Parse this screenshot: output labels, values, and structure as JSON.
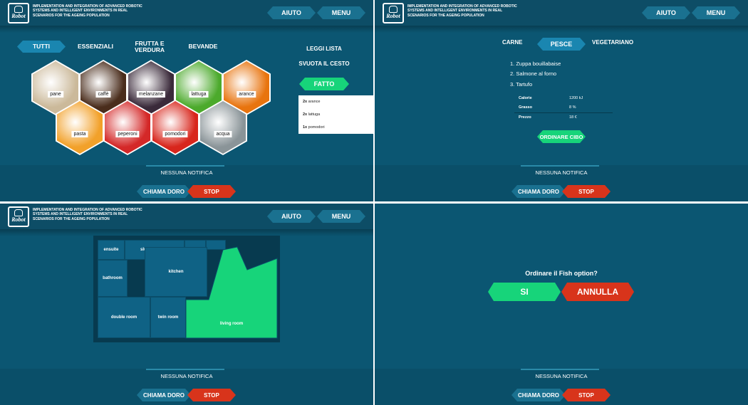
{
  "header": {
    "logo_text": "Robot",
    "project_text": "IMPLEMENTATION AND INTEGRATION OF ADVANCED ROBOTIC SYSTEMS AND INTELLIGENT ENVIRONMENTS IN REAL SCENARIOS FOR THE AGEING POPULATION",
    "aiuto": "AIUTO",
    "menu": "MENU"
  },
  "footer": {
    "notifica": "NESSUNA NOTIFICA",
    "chiama": "CHIAMA DORO",
    "stop": "STOP"
  },
  "shopping": {
    "tabs": [
      "TUTTI",
      "ESSENZIALI",
      "FRUTTA E VERDURA",
      "BEVANDE"
    ],
    "active_tab": "TUTTI",
    "items": [
      {
        "label": "pane",
        "color": "#cbb99a"
      },
      {
        "label": "caffè",
        "color": "#4a2d1c"
      },
      {
        "label": "melanzane",
        "color": "#3a2a3a"
      },
      {
        "label": "lattuga",
        "color": "#4caa2c"
      },
      {
        "label": "arance",
        "color": "#e8740e"
      },
      {
        "label": "pasta",
        "color": "#f2a12a"
      },
      {
        "label": "peperoni",
        "color": "#d42828"
      },
      {
        "label": "pomodori",
        "color": "#d8261c"
      },
      {
        "label": "acqua",
        "color": "#8a9498"
      }
    ],
    "leggi_lista": "LEGGI LISTA",
    "svuota": "SVUOTA IL CESTO",
    "fatto": "FATTO",
    "cart": [
      {
        "qty": "2x",
        "name": "arance"
      },
      {
        "qty": "2x",
        "name": "lattuga"
      },
      {
        "qty": "1x",
        "name": "pomodori"
      }
    ]
  },
  "food": {
    "tabs": [
      "CARNE",
      "PESCE",
      "VEGETARIANO"
    ],
    "active_tab": "PESCE",
    "dishes": [
      "1.  Zuppa bouillabaise",
      "2.  Salmone al forno",
      "3.  Tartufo"
    ],
    "nutrition": [
      {
        "label": "Calorie",
        "value": "1200 kJ"
      },
      {
        "label": "Grasso",
        "value": "8 %"
      },
      {
        "label": "Prezzo",
        "value": "18 €"
      }
    ],
    "order_button": "ORDINARE CIBO"
  },
  "map": {
    "rooms": [
      "ensuite",
      "slumber room",
      "bathroom",
      "kitchen",
      "double room",
      "twin room",
      "living room"
    ],
    "highlighted_room": "living room",
    "highlight_color": "#17d47a"
  },
  "confirm": {
    "question": "Ordinare il Fish option?",
    "yes": "SI",
    "no": "ANNULLA"
  }
}
